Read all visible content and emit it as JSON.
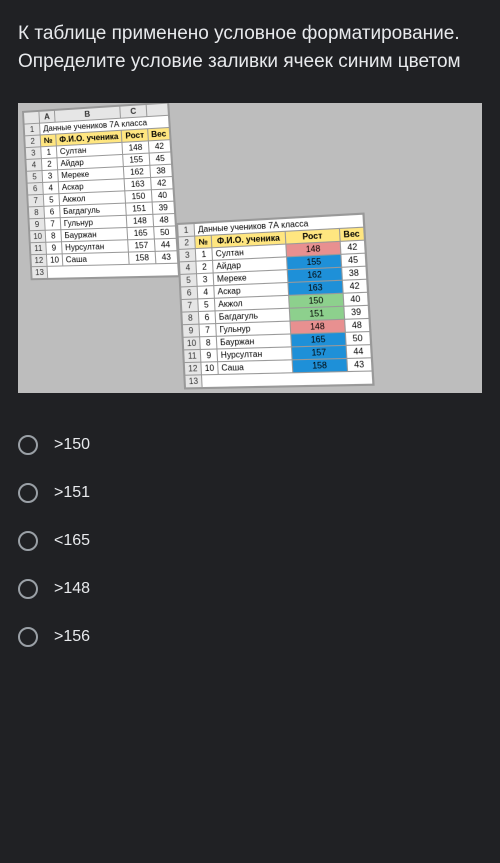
{
  "question": "К таблице применено условное форматирование. Определите условие заливки ячеек синим цветом",
  "sheet_title": "Данные учеников 7А класса",
  "colA": "A",
  "colB": "B",
  "colC": "C",
  "h_no": "№",
  "h_fio": "Ф.И.О. ученика",
  "h_rost": "Рост",
  "h_ves": "Вес",
  "rows": [
    {
      "n": "1",
      "name": "Султан",
      "rost": "148",
      "ves": "42"
    },
    {
      "n": "2",
      "name": "Айдар",
      "rost": "155",
      "ves": "45"
    },
    {
      "n": "3",
      "name": "Мереке",
      "rost": "162",
      "ves": "38"
    },
    {
      "n": "4",
      "name": "Аскар",
      "rost": "163",
      "ves": "42"
    },
    {
      "n": "5",
      "name": "Акжол",
      "rost": "150",
      "ves": "40"
    },
    {
      "n": "6",
      "name": "Багдагуль",
      "rost": "151",
      "ves": "39"
    },
    {
      "n": "7",
      "name": "Гульнур",
      "rost": "148",
      "ves": "48"
    },
    {
      "n": "8",
      "name": "Бауржан",
      "rost": "165",
      "ves": "50"
    },
    {
      "n": "9",
      "name": "Нурсултан",
      "rost": "157",
      "ves": "44"
    },
    {
      "n": "10",
      "name": "Саша",
      "rost": "158",
      "ves": "43"
    }
  ],
  "chart_data": {
    "type": "table",
    "title": "Данные учеников 7А класса",
    "columns": [
      "№",
      "Ф.И.О. ученика",
      "Рост",
      "Вес"
    ],
    "rows": [
      [
        1,
        "Султан",
        148,
        42
      ],
      [
        2,
        "Айдар",
        155,
        45
      ],
      [
        3,
        "Мереке",
        162,
        38
      ],
      [
        4,
        "Аскар",
        163,
        42
      ],
      [
        5,
        "Акжол",
        150,
        40
      ],
      [
        6,
        "Багдагуль",
        151,
        39
      ],
      [
        7,
        "Гульнур",
        148,
        48
      ],
      [
        8,
        "Бауржан",
        165,
        50
      ],
      [
        9,
        "Нурсултан",
        157,
        44
      ],
      [
        10,
        "Саша",
        158,
        43
      ]
    ],
    "conditional_formatting_on_column": "Рост",
    "cell_fills": {
      "148": "red",
      "155": "blue",
      "162": "blue",
      "163": "blue",
      "150": "green",
      "151": "green",
      "165": "blue",
      "157": "blue",
      "158": "blue"
    }
  },
  "options": [
    ">150",
    ">151",
    "<165",
    ">148",
    ">156"
  ]
}
